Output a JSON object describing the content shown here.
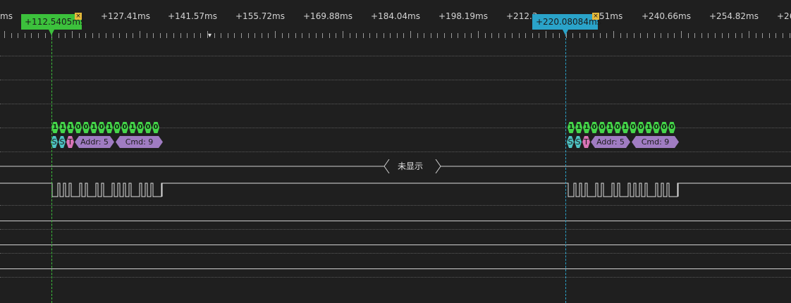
{
  "ruler": {
    "labels": [
      "ms",
      "+127.41ms",
      "+141.57ms",
      "+155.72ms",
      "+169.88ms",
      "+184.04ms",
      "+198.19ms",
      "+212.3",
      "51ms",
      "+240.66ms",
      "+254.82ms",
      "+26"
    ]
  },
  "markers": [
    {
      "label": "+112.5405ms",
      "color": "#3cc13c",
      "pin": "1"
    },
    {
      "label": "+220.08084ms",
      "color": "#2aa3c9",
      "pin": "2"
    }
  ],
  "decoded": {
    "bits": [
      "1",
      "1",
      "1",
      "0",
      "0",
      "1",
      "0",
      "1",
      "0",
      "0",
      "1",
      "0",
      "0",
      "0",
      "1"
    ],
    "start1": "S",
    "start2": "S",
    "t": "T",
    "addr": "Addr: 5",
    "cmd": "Cmd: 9"
  },
  "collapsed": {
    "label": "未显示"
  },
  "colors": {
    "background": "#1f1f1f",
    "bit_green": "#45d64a",
    "proto_purple": "#a07cc2",
    "start_cyan": "#4fc3c3",
    "t_pink": "#d874b6"
  }
}
